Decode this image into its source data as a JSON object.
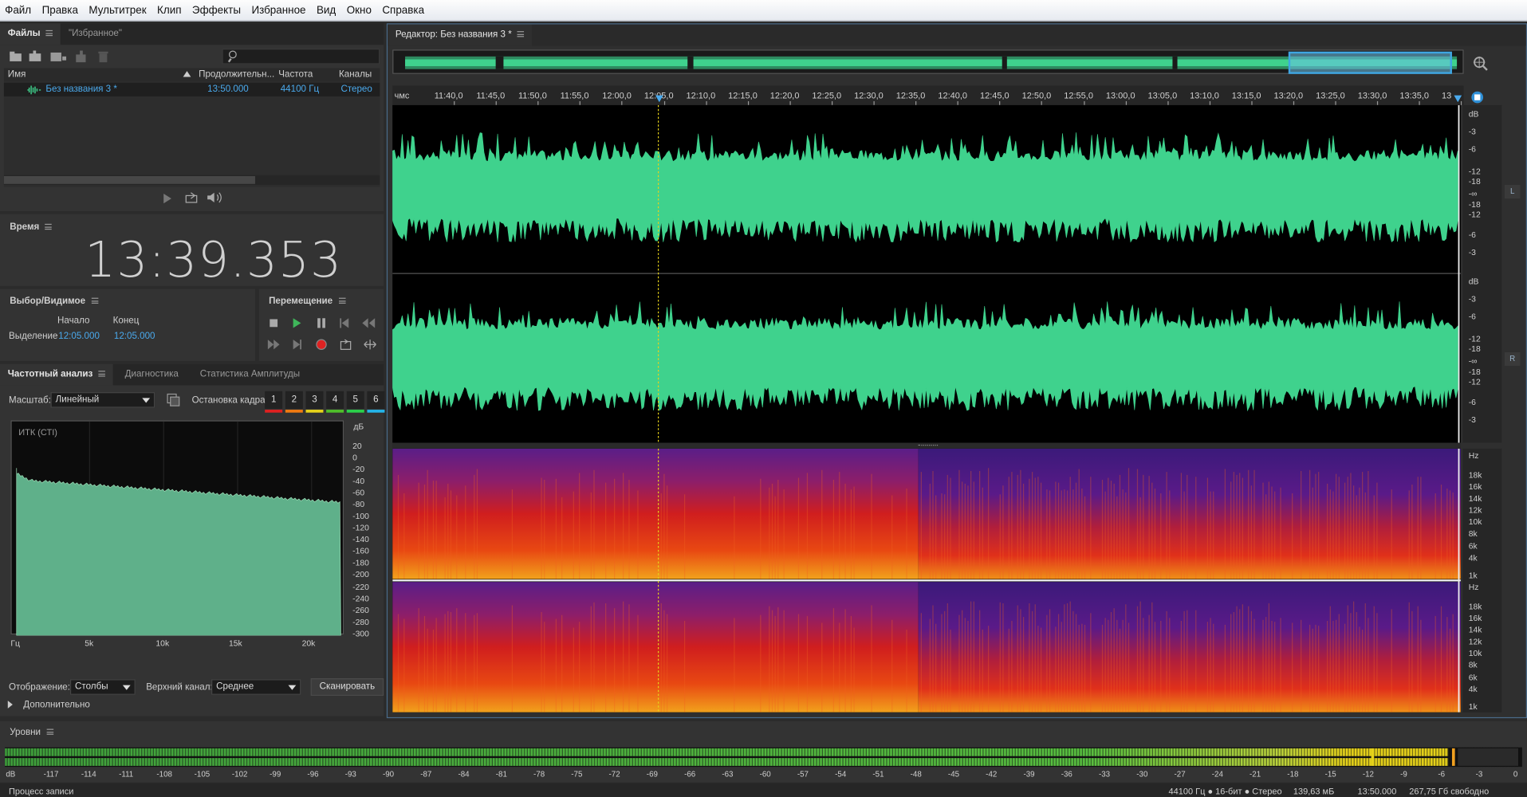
{
  "menu": [
    "Файл",
    "Правка",
    "Мультитрек",
    "Клип",
    "Эффекты",
    "Избранное",
    "Вид",
    "Окно",
    "Справка"
  ],
  "files_panel": {
    "tabs": [
      "Файлы",
      "\"Избранное\""
    ],
    "columns": [
      "Имя",
      "Продолжительн...",
      "Частота",
      "Каналы"
    ],
    "row": {
      "name": "Без названия 3 *",
      "duration": "13:50.000",
      "rate": "44100 Гц",
      "channels": "Стерео"
    }
  },
  "time_panel": {
    "title": "Время",
    "time": "13:39.353"
  },
  "selection_panel": {
    "title": "Выбор/Видимое",
    "start_label": "Начало",
    "end_label": "Конец",
    "selection_label": "Выделение",
    "start": "12:05.000",
    "end": "12:05.000"
  },
  "transport_panel": {
    "title": "Перемещение"
  },
  "freq_panel": {
    "tabs": [
      "Частотный анализ",
      "Диагностика",
      "Статистика Амплитуды"
    ],
    "scale_label": "Масштаб:",
    "scale_value": "Линейный",
    "hold_label": "Остановка кадра:",
    "hold_buttons": [
      "1",
      "2",
      "3",
      "4",
      "5",
      "6"
    ],
    "hold_colors": [
      "#e02020",
      "#f07a10",
      "#e6d21a",
      "#4fbf2a",
      "#2ad04a",
      "#24b4e8"
    ],
    "plot_title": "ИТК (СТI)",
    "db_unit": "дБ",
    "db_ticks": [
      "20",
      "0",
      "-20",
      "-40",
      "-60",
      "-80",
      "-100",
      "-120",
      "-140",
      "-160",
      "-180",
      "-200",
      "-220",
      "-240",
      "-260",
      "-280",
      "-300"
    ],
    "x_ticks": [
      "Гц",
      "5k",
      "10k",
      "15k",
      "20k"
    ],
    "display_label": "Отображение:",
    "display_value": "Столбы",
    "channel_label": "Верхний канал:",
    "channel_value": "Среднее",
    "scan_button": "Сканировать",
    "more_label": "Дополнительно"
  },
  "editor": {
    "title": "Редактор: Без названия 3 *",
    "ruler_unit": "чмс",
    "ruler": [
      "11:40,0",
      "11:45,0",
      "11:50,0",
      "11:55,0",
      "12:00,0",
      "12:05,0",
      "12:10,0",
      "12:15,0",
      "12:20,0",
      "12:25,0",
      "12:30,0",
      "12:35,0",
      "12:40,0",
      "12:45,0",
      "12:50,0",
      "12:55,0",
      "13:00,0",
      "13:05,0",
      "13:10,0",
      "13:15,0",
      "13:20,0",
      "13:25,0",
      "13:30,0",
      "13:35,0",
      "13"
    ],
    "wave_db_ticks": [
      "dB",
      "-3",
      "-6",
      "-12",
      "-18",
      "-∞",
      "-18",
      "-12",
      "-6",
      "-3"
    ],
    "spec_ticks": [
      "Hz",
      "18k",
      "16k",
      "14k",
      "12k",
      "10k",
      "8k",
      "6k",
      "4k",
      "1k"
    ],
    "channel_left": "L",
    "channel_right": "R",
    "waveform_color": "#3fd28d"
  },
  "levels": {
    "title": "Уровни",
    "ticks": [
      "dB",
      "-117",
      "-114",
      "-111",
      "-108",
      "-105",
      "-102",
      "-99",
      "-96",
      "-93",
      "-90",
      "-87",
      "-84",
      "-81",
      "-78",
      "-75",
      "-72",
      "-69",
      "-66",
      "-63",
      "-60",
      "-57",
      "-54",
      "-51",
      "-48",
      "-45",
      "-42",
      "-39",
      "-36",
      "-33",
      "-30",
      "-27",
      "-24",
      "-21",
      "-18",
      "-15",
      "-12",
      "-9",
      "-6",
      "-3",
      "0"
    ]
  },
  "status": {
    "left": "Процесс записи",
    "format": "44100 Гц ● 16-бит ● Стерео",
    "size": "139,63 мБ",
    "duration": "13:50.000",
    "free": "267,75 Гб свободно"
  }
}
